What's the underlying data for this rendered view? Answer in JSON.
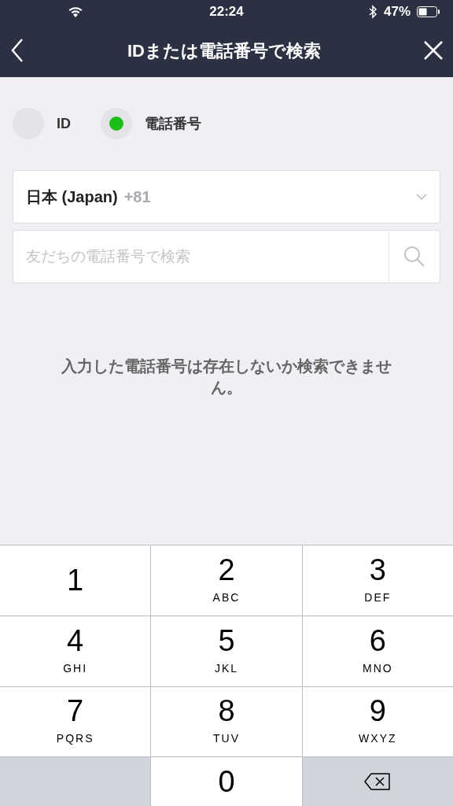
{
  "status_bar": {
    "time": "22:24",
    "battery": "47%"
  },
  "nav": {
    "title": "IDまたは電話番号で検索"
  },
  "search_type": [
    {
      "label": "ID",
      "selected": false
    },
    {
      "label": "電話番号",
      "selected": true
    }
  ],
  "country": {
    "name": "日本 (Japan)",
    "code": "+81"
  },
  "search": {
    "placeholder": "友だちの電話番号で検索"
  },
  "message": "入力した電話番号は存在しないか検索できません。",
  "keypad": [
    {
      "kind": "digit",
      "digit": "1"
    },
    {
      "kind": "digit",
      "digit": "2",
      "letters": "ABC"
    },
    {
      "kind": "digit",
      "digit": "3",
      "letters": "DEF"
    },
    {
      "kind": "digit",
      "digit": "4",
      "letters": "GHI"
    },
    {
      "kind": "digit",
      "digit": "5",
      "letters": "JKL"
    },
    {
      "kind": "digit",
      "digit": "6",
      "letters": "MNO"
    },
    {
      "kind": "digit",
      "digit": "7",
      "letters": "PQRS"
    },
    {
      "kind": "digit",
      "digit": "8",
      "letters": "TUV"
    },
    {
      "kind": "digit",
      "digit": "9",
      "letters": "WXYZ"
    },
    {
      "kind": "blank"
    },
    {
      "kind": "digit",
      "digit": "0"
    },
    {
      "kind": "delete"
    }
  ]
}
